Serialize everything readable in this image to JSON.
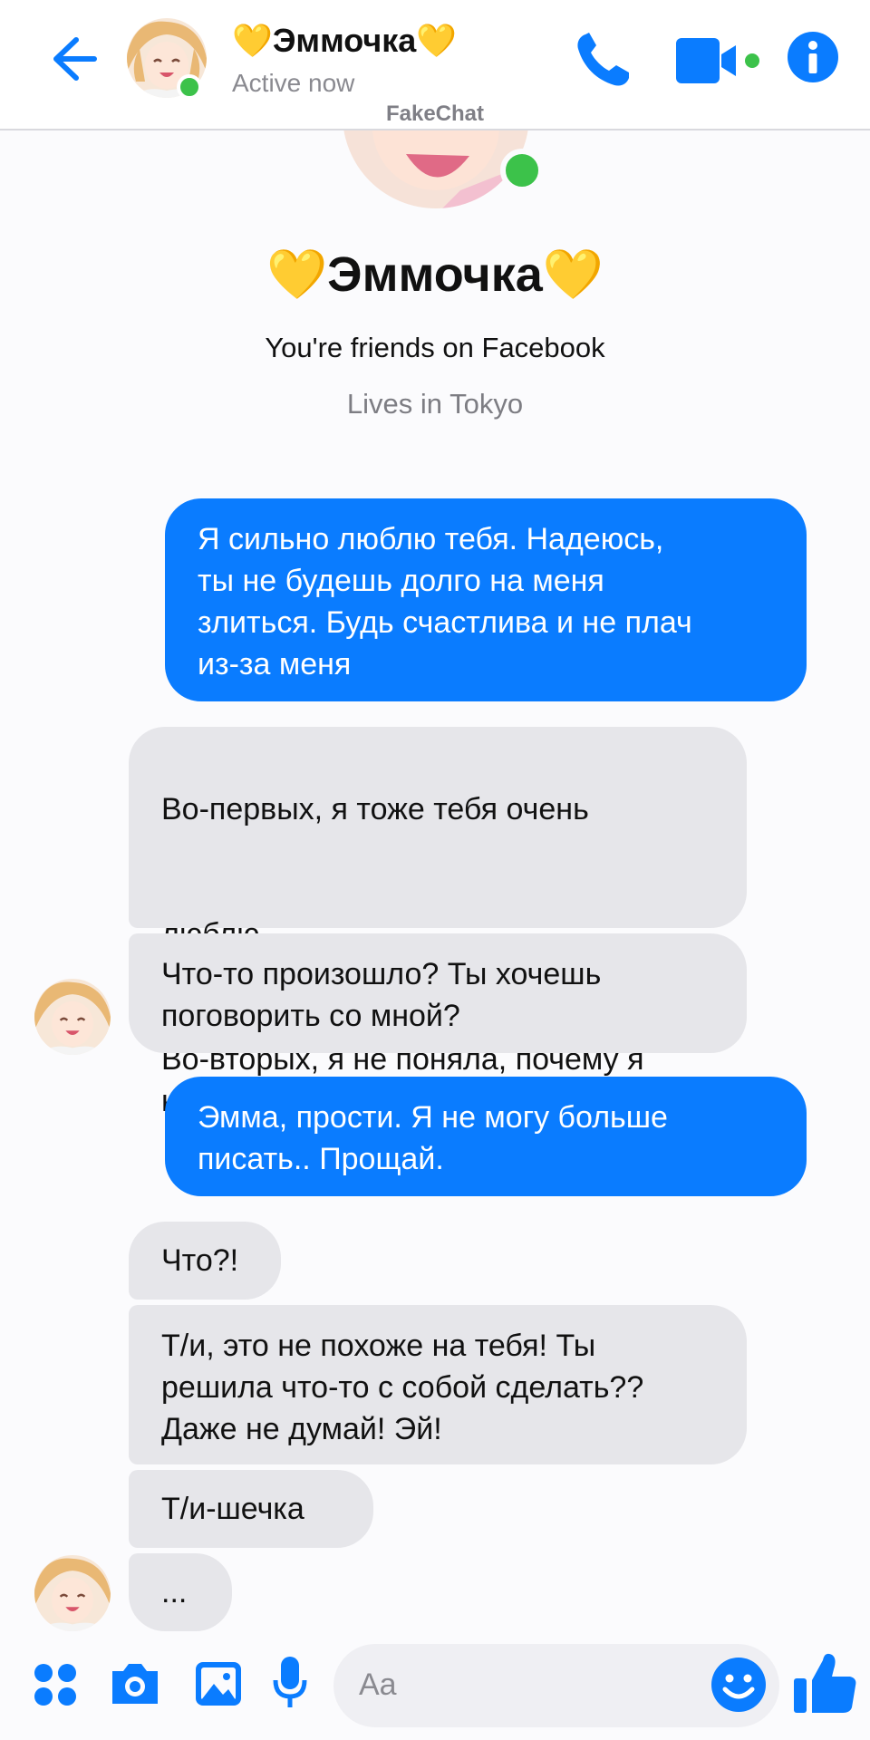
{
  "header": {
    "name": "💛Эммочка💛",
    "status": "Active now",
    "watermark": "FakeChat"
  },
  "profile": {
    "name": "💛Эммочка💛",
    "friends": "You're friends on Facebook",
    "lives": "Lives in Tokyo"
  },
  "messages": [
    {
      "dir": "out",
      "text": "Я сильно люблю тебя. Надеюсь,\nты не будешь долго на меня\nзлиться. Будь счастлива и не плач\nиз-за меня"
    },
    {
      "dir": "in",
      "text_line1": "Во-первых, я тоже тебя очень",
      "text_line2": "люблю",
      "text_rest": "Во-вторых, я не поняла, почему я\nне должна плакать",
      "emoji": "💗💗"
    },
    {
      "dir": "in",
      "text": "Что-то произошло? Ты хочешь\nпоговорить со мной?"
    },
    {
      "dir": "out",
      "text": "Эмма, прости. Я не могу больше\nписать.. Прощай."
    },
    {
      "dir": "in",
      "text": "Что?!"
    },
    {
      "dir": "in",
      "text": "Т/и, это не похоже на тебя! Ты\nрешила что-то с собой сделать??\nДаже не думай! Эй!"
    },
    {
      "dir": "in",
      "text": "Т/и-шечка"
    },
    {
      "dir": "in",
      "text": "..."
    }
  ],
  "composer": {
    "placeholder": "Aa"
  },
  "icons": {
    "back": "back-arrow-icon",
    "call": "phone-icon",
    "video": "video-camera-icon",
    "info": "info-icon",
    "apps": "apps-grid-icon",
    "camera": "camera-icon",
    "gallery": "image-icon",
    "mic": "microphone-icon",
    "emoji": "emoji-icon",
    "like": "thumbs-up-icon"
  },
  "colors": {
    "accent": "#0a7cff",
    "incoming_bubble": "#e6e6ea",
    "online": "#3cc24a"
  }
}
